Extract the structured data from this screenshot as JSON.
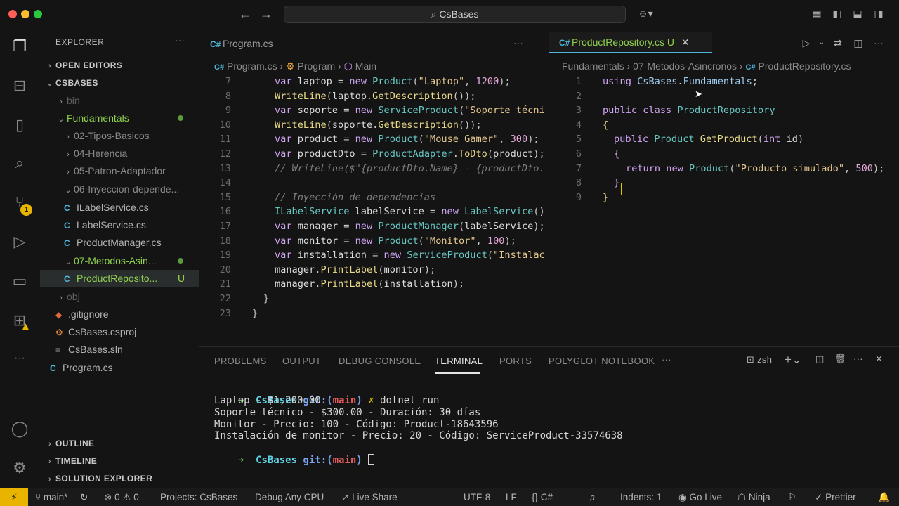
{
  "window": {
    "title": "CsBases"
  },
  "activity_badges": {
    "source_control": "1"
  },
  "sidebar": {
    "title": "EXPLORER",
    "more": "···",
    "sections": {
      "open_editors": "OPEN EDITORS",
      "project": "CSBASES",
      "outline": "OUTLINE",
      "timeline": "TIMELINE",
      "solution_explorer": "SOLUTION EXPLORER"
    },
    "tree": [
      {
        "label": "bin",
        "kind": "folder",
        "dim": true
      },
      {
        "label": "Fundamentals",
        "kind": "folder-open",
        "git": "modified"
      },
      {
        "label": "02-Tipos-Basicos",
        "kind": "folder"
      },
      {
        "label": "04-Herencia",
        "kind": "folder"
      },
      {
        "label": "05-Patron-Adaptador",
        "kind": "folder"
      },
      {
        "label": "06-Inyeccion-depende...",
        "kind": "folder-open"
      },
      {
        "label": "ILabelService.cs",
        "kind": "cs"
      },
      {
        "label": "LabelService.cs",
        "kind": "cs"
      },
      {
        "label": "ProductManager.cs",
        "kind": "cs"
      },
      {
        "label": "07-Metodos-Asin...",
        "kind": "folder-open",
        "git": "untracked"
      },
      {
        "label": "ProductReposito...",
        "kind": "cs",
        "status": "U"
      },
      {
        "label": "obj",
        "kind": "folder",
        "dim": true
      },
      {
        "label": ".gitignore",
        "kind": "git"
      },
      {
        "label": "CsBases.csproj",
        "kind": "proj"
      },
      {
        "label": "CsBases.sln",
        "kind": "sln"
      },
      {
        "label": "Program.cs",
        "kind": "cs"
      }
    ]
  },
  "editor_left": {
    "tab": "Program.cs",
    "breadcrumb": [
      "Program.cs",
      "Program",
      "Main"
    ],
    "lines": [
      {
        "n": "7",
        "tokens": [
          [
            "kw",
            "var "
          ],
          [
            "id",
            "laptop "
          ],
          [
            "pu",
            "= "
          ],
          [
            "kw",
            "new "
          ],
          [
            "ty",
            "Product"
          ],
          [
            "pu",
            "("
          ],
          [
            "st",
            "\"Laptop\""
          ],
          [
            "pu",
            ", "
          ],
          [
            "nm",
            "1200"
          ],
          [
            "pu",
            ");"
          ]
        ]
      },
      {
        "n": "8",
        "tokens": [
          [
            "fn",
            "WriteLine"
          ],
          [
            "pu",
            "("
          ],
          [
            "id",
            "laptop"
          ],
          [
            "pu",
            "."
          ],
          [
            "fn",
            "GetDescription"
          ],
          [
            "pu",
            "());"
          ]
        ]
      },
      {
        "n": "9",
        "tokens": [
          [
            "kw",
            "var "
          ],
          [
            "id",
            "soporte "
          ],
          [
            "pu",
            "= "
          ],
          [
            "kw",
            "new "
          ],
          [
            "ty",
            "ServiceProduct"
          ],
          [
            "pu",
            "("
          ],
          [
            "st",
            "\"Soporte técni"
          ]
        ]
      },
      {
        "n": "10",
        "tokens": [
          [
            "fn",
            "WriteLine"
          ],
          [
            "pu",
            "("
          ],
          [
            "id",
            "soporte"
          ],
          [
            "pu",
            "."
          ],
          [
            "fn",
            "GetDescription"
          ],
          [
            "pu",
            "());"
          ]
        ]
      },
      {
        "n": "11",
        "tokens": [
          [
            "kw",
            "var "
          ],
          [
            "id",
            "product "
          ],
          [
            "pu",
            "= "
          ],
          [
            "kw",
            "new "
          ],
          [
            "ty",
            "Product"
          ],
          [
            "pu",
            "("
          ],
          [
            "st",
            "\"Mouse Gamer\""
          ],
          [
            "pu",
            ", "
          ],
          [
            "nm",
            "300"
          ],
          [
            "pu",
            ");"
          ]
        ]
      },
      {
        "n": "12",
        "tokens": [
          [
            "kw",
            "var "
          ],
          [
            "id",
            "productDto "
          ],
          [
            "pu",
            "= "
          ],
          [
            "ty",
            "ProductAdapter"
          ],
          [
            "pu",
            "."
          ],
          [
            "fn",
            "ToDto"
          ],
          [
            "pu",
            "("
          ],
          [
            "id",
            "product"
          ],
          [
            "pu",
            ");"
          ]
        ]
      },
      {
        "n": "13",
        "tokens": [
          [
            "cm",
            "// WriteLine($\"{productDto.Name} - {productDto."
          ]
        ]
      },
      {
        "n": "14",
        "tokens": []
      },
      {
        "n": "15",
        "tokens": [
          [
            "cm",
            "// Inyección de dependencias"
          ]
        ]
      },
      {
        "n": "16",
        "tokens": [
          [
            "ty",
            "ILabelService "
          ],
          [
            "id",
            "labelService "
          ],
          [
            "pu",
            "= "
          ],
          [
            "kw",
            "new "
          ],
          [
            "ty",
            "LabelService"
          ],
          [
            "pu",
            "()"
          ]
        ]
      },
      {
        "n": "17",
        "tokens": [
          [
            "kw",
            "var "
          ],
          [
            "id",
            "manager "
          ],
          [
            "pu",
            "= "
          ],
          [
            "kw",
            "new "
          ],
          [
            "ty",
            "ProductManager"
          ],
          [
            "pu",
            "("
          ],
          [
            "id",
            "labelService"
          ],
          [
            "pu",
            ");"
          ]
        ]
      },
      {
        "n": "18",
        "tokens": [
          [
            "kw",
            "var "
          ],
          [
            "id",
            "monitor "
          ],
          [
            "pu",
            "= "
          ],
          [
            "kw",
            "new "
          ],
          [
            "ty",
            "Product"
          ],
          [
            "pu",
            "("
          ],
          [
            "st",
            "\"Monitor\""
          ],
          [
            "pu",
            ", "
          ],
          [
            "nm",
            "100"
          ],
          [
            "pu",
            ");"
          ]
        ]
      },
      {
        "n": "19",
        "tokens": [
          [
            "kw",
            "var "
          ],
          [
            "id",
            "installation "
          ],
          [
            "pu",
            "= "
          ],
          [
            "kw",
            "new "
          ],
          [
            "ty",
            "ServiceProduct"
          ],
          [
            "pu",
            "("
          ],
          [
            "st",
            "\"Instalac"
          ]
        ]
      },
      {
        "n": "20",
        "tokens": [
          [
            "id",
            "manager"
          ],
          [
            "pu",
            "."
          ],
          [
            "fn",
            "PrintLabel"
          ],
          [
            "pu",
            "("
          ],
          [
            "id",
            "monitor"
          ],
          [
            "pu",
            ");"
          ]
        ]
      },
      {
        "n": "21",
        "tokens": [
          [
            "id",
            "manager"
          ],
          [
            "pu",
            "."
          ],
          [
            "fn",
            "PrintLabel"
          ],
          [
            "pu",
            "("
          ],
          [
            "id",
            "installation"
          ],
          [
            "pu",
            ");"
          ]
        ]
      },
      {
        "n": "22",
        "tokens": [
          [
            "pu",
            "}"
          ]
        ]
      },
      {
        "n": "23",
        "tokens": [
          [
            "pu",
            "}"
          ]
        ]
      }
    ]
  },
  "editor_right": {
    "tab": "ProductRepository.cs",
    "tab_status": "U",
    "breadcrumb": [
      "Fundamentals",
      "07-Metodos-Asincronos",
      "ProductRepository.cs"
    ],
    "lines": [
      {
        "n": "1",
        "tokens": [
          [
            "kw",
            "using "
          ],
          [
            "ns",
            "CsBases"
          ],
          [
            "pu",
            "."
          ],
          [
            "ns",
            "Fundamentals"
          ],
          [
            "pu",
            ";"
          ]
        ]
      },
      {
        "n": "2",
        "tokens": []
      },
      {
        "n": "3",
        "tokens": [
          [
            "kw",
            "public class "
          ],
          [
            "ty",
            "ProductRepository"
          ]
        ]
      },
      {
        "n": "4",
        "tokens": [
          [
            "fn",
            "{"
          ]
        ]
      },
      {
        "n": "5",
        "tokens": [
          [
            "kw",
            "public "
          ],
          [
            "ty",
            "Product "
          ],
          [
            "fn",
            "GetProduct"
          ],
          [
            "pu",
            "("
          ],
          [
            "kw",
            "int "
          ],
          [
            "id",
            "id"
          ],
          [
            "pu",
            ")"
          ]
        ]
      },
      {
        "n": "6",
        "tokens": [
          [
            "kw",
            "{"
          ]
        ]
      },
      {
        "n": "7",
        "tokens": [
          [
            "kw",
            "return new "
          ],
          [
            "ty",
            "Product"
          ],
          [
            "pu",
            "("
          ],
          [
            "st",
            "\"Producto simulado\""
          ],
          [
            "pu",
            ", "
          ],
          [
            "nm",
            "500"
          ],
          [
            "pu",
            ");"
          ]
        ]
      },
      {
        "n": "8",
        "tokens": [
          [
            "kw",
            "}"
          ]
        ]
      },
      {
        "n": "9",
        "tokens": [
          [
            "fn",
            "}"
          ]
        ]
      }
    ]
  },
  "panel": {
    "tabs": [
      "PROBLEMS",
      "OUTPUT",
      "DEBUG CONSOLE",
      "TERMINAL",
      "PORTS",
      "POLYGLOT NOTEBOOK"
    ],
    "active_tab": "TERMINAL",
    "more": "···",
    "shell": "zsh",
    "terminal": {
      "prompt_arrow": "➜",
      "dir": "CsBases",
      "git": "git:(",
      "branch": "main",
      "git_close": ")",
      "dirty": "✗",
      "command": "dotnet run",
      "output": [
        "Laptop - $1,200.00",
        "Soporte técnico - $300.00 - Duración: 30 días",
        "Monitor - Precio: 100 - Código: Product-18643596",
        "Instalación de monitor - Precio: 20 - Código: ServiceProduct-33574638"
      ]
    }
  },
  "statusbar": {
    "branch": "main*",
    "errors": "0",
    "warnings": "0",
    "projects": "Projects: CsBases",
    "debug": "Debug Any CPU",
    "live_share": "Live Share",
    "encoding": "UTF-8",
    "eol": "LF",
    "language": "C#",
    "indents": "Indents: 1",
    "go_live": "Go Live",
    "ninja": "Ninja",
    "prettier": "Prettier"
  },
  "colors": {
    "accent": "#4fb6d9",
    "modified": "#5a9b3c",
    "untracked_text": "#8fd14f",
    "statusbar_remote": "#e8b400"
  }
}
